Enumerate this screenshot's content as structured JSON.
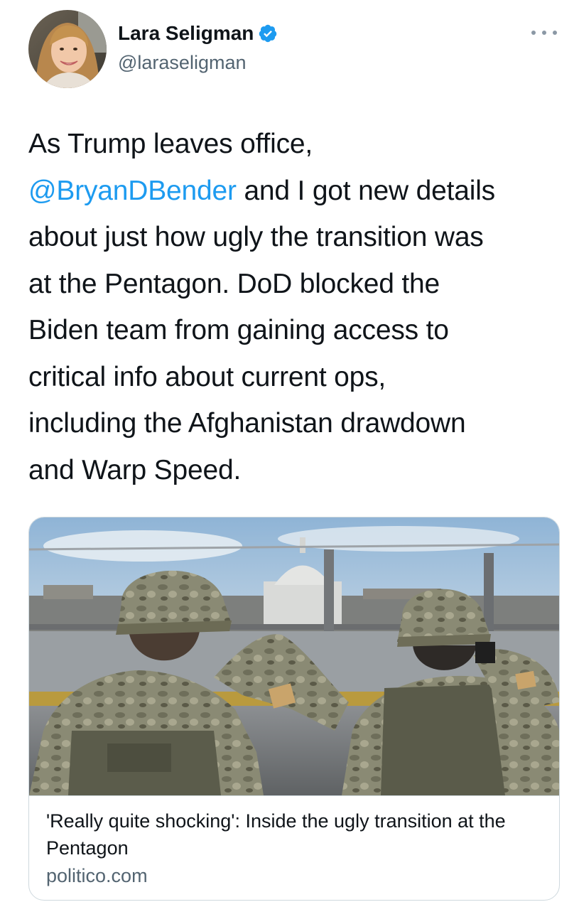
{
  "author": {
    "display_name": "Lara Seligman",
    "handle": "@laraseligman",
    "verified": true
  },
  "icons": {
    "verified": "verified-badge-icon",
    "more": "more-options-icon"
  },
  "tweet": {
    "lines": [
      "As Trump leaves office,",
      "and I got new details",
      "about just how ugly the transition was",
      "at the Pentagon. DoD blocked the",
      "Biden team from gaining access to",
      "critical info about current ops,",
      "including the Afghanistan drawdown",
      "and Warp Speed."
    ],
    "mention": "@BryanDBender"
  },
  "link_card": {
    "title": "'Really quite shocking': Inside the ugly transition at the Pentagon",
    "domain": "politico.com"
  },
  "colors": {
    "link": "#1d9bf0",
    "text": "#0f1419",
    "secondary": "#536471",
    "verified": "#1d9bf0",
    "border": "#cfd9de"
  }
}
